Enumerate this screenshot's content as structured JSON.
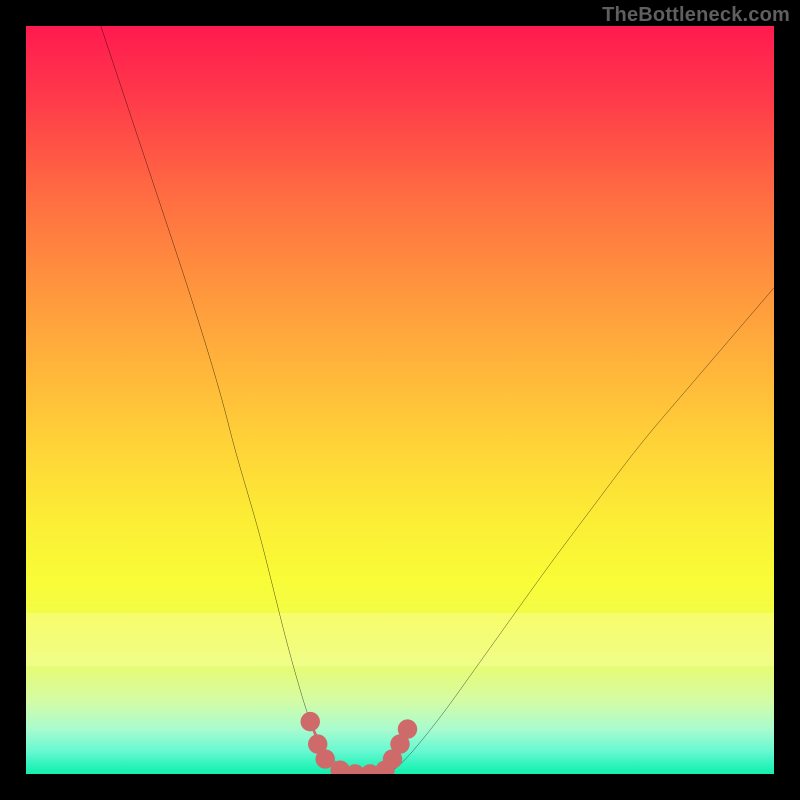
{
  "watermark": "TheBottleneck.com",
  "chart_data": {
    "type": "line",
    "title": "",
    "xlabel": "",
    "ylabel": "",
    "xlim": [
      0,
      100
    ],
    "ylim": [
      0,
      100
    ],
    "series": [
      {
        "name": "bottleneck-curve",
        "x": [
          10,
          14,
          18,
          22,
          26,
          28,
          31,
          33,
          35,
          37,
          38,
          40,
          42,
          44,
          46,
          48,
          50,
          55,
          60,
          65,
          70,
          76,
          82,
          88,
          94,
          100
        ],
        "y": [
          100,
          88,
          76,
          64,
          51,
          43,
          33,
          25,
          17,
          10,
          7,
          3,
          1,
          0,
          0,
          0,
          1,
          7,
          14,
          21,
          28,
          36,
          44,
          51,
          58,
          65
        ]
      }
    ],
    "markers": {
      "name": "bottom-dots",
      "color": "#cf6a6a",
      "points": [
        {
          "x": 38,
          "y": 7
        },
        {
          "x": 39,
          "y": 4
        },
        {
          "x": 40,
          "y": 2
        },
        {
          "x": 42,
          "y": 0.5
        },
        {
          "x": 44,
          "y": 0
        },
        {
          "x": 46,
          "y": 0
        },
        {
          "x": 48,
          "y": 0.5
        },
        {
          "x": 49,
          "y": 2
        },
        {
          "x": 50,
          "y": 4
        },
        {
          "x": 51,
          "y": 6
        }
      ]
    },
    "bottom_segment": {
      "color": "#cf6a6a",
      "x": [
        38,
        40,
        42,
        44,
        46,
        48,
        50,
        51
      ],
      "y": [
        7,
        2,
        0.5,
        0,
        0,
        0.5,
        3,
        6
      ]
    }
  }
}
